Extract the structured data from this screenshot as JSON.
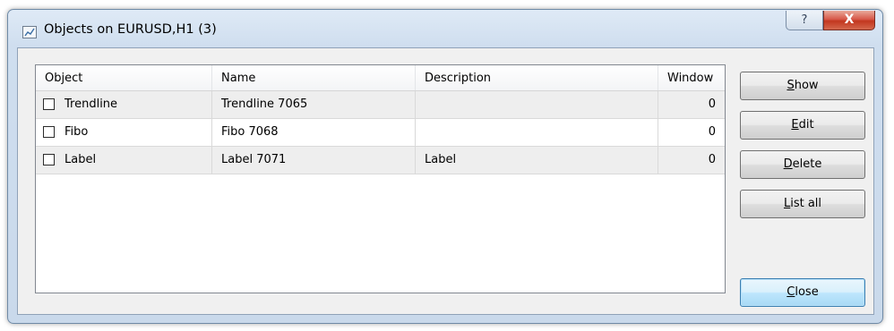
{
  "window": {
    "title": "Objects on EURUSD,H1 (3)",
    "help_label": "?",
    "close_label": "X"
  },
  "list": {
    "columns": [
      "Object",
      "Name",
      "Description",
      "Window"
    ],
    "rows": [
      {
        "checked": false,
        "object": "Trendline",
        "name": "Trendline 7065",
        "description": "",
        "window": "0"
      },
      {
        "checked": false,
        "object": "Fibo",
        "name": "Fibo 7068",
        "description": "",
        "window": "0"
      },
      {
        "checked": false,
        "object": "Label",
        "name": "Label 7071",
        "description": "Label",
        "window": "0"
      }
    ]
  },
  "buttons": {
    "show": {
      "mnemonic": "S",
      "rest": "how"
    },
    "edit": {
      "mnemonic": "E",
      "rest": "dit"
    },
    "delete": {
      "mnemonic": "D",
      "rest": "elete"
    },
    "list_all": {
      "mnemonic": "L",
      "rest": "ist all"
    },
    "close": {
      "mnemonic": "C",
      "rest": "lose"
    }
  },
  "icons": {
    "app": "chart-icon",
    "help": "help-icon",
    "close": "close-icon"
  },
  "colors": {
    "close_button": "#c9402a",
    "default_button_border": "#3c7fb1"
  }
}
